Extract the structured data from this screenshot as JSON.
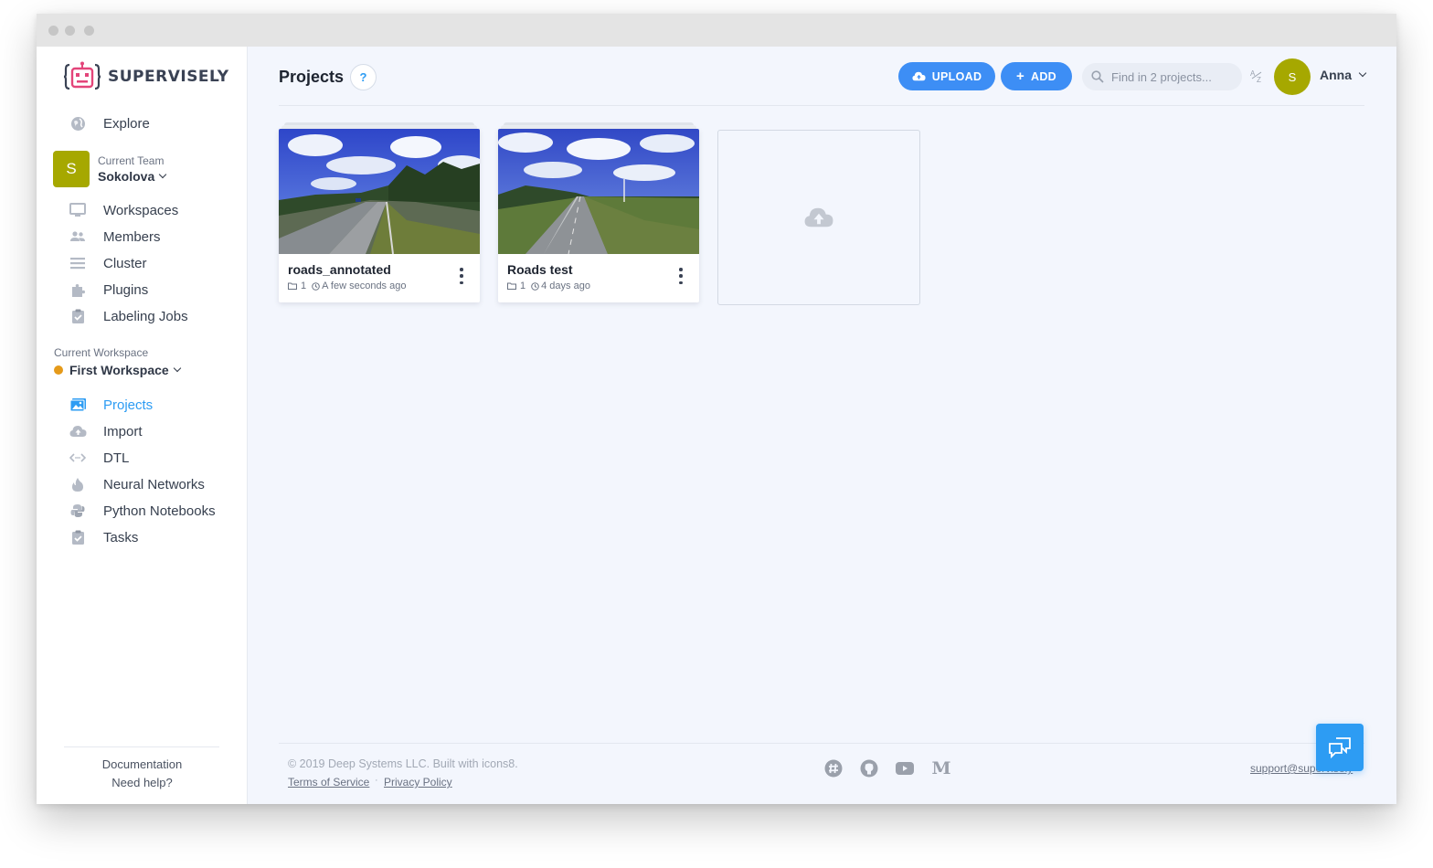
{
  "window": {
    "traffic_lights": [
      "close",
      "minimize",
      "maximize"
    ]
  },
  "brand": {
    "name": "SUPERVISELY",
    "logo_color": "#e3457a"
  },
  "sidebar": {
    "explore": {
      "label": "Explore",
      "icon": "globe-icon"
    },
    "team": {
      "caption": "Current Team",
      "name": "Sokolova",
      "initial": "S",
      "color": "#a6a800"
    },
    "team_items": [
      {
        "label": "Workspaces",
        "icon": "monitor-icon"
      },
      {
        "label": "Members",
        "icon": "people-icon"
      },
      {
        "label": "Cluster",
        "icon": "list-icon"
      },
      {
        "label": "Plugins",
        "icon": "puzzle-icon"
      },
      {
        "label": "Labeling Jobs",
        "icon": "clipboard-check-icon"
      }
    ],
    "workspace": {
      "caption": "Current Workspace",
      "name": "First Workspace",
      "status_color": "#e59a1a"
    },
    "workspace_items": [
      {
        "label": "Projects",
        "icon": "images-icon",
        "active": true
      },
      {
        "label": "Import",
        "icon": "cloud-upload-icon"
      },
      {
        "label": "DTL",
        "icon": "code-icon"
      },
      {
        "label": "Neural Networks",
        "icon": "flame-icon"
      },
      {
        "label": "Python Notebooks",
        "icon": "python-icon"
      },
      {
        "label": "Tasks",
        "icon": "clipboard-check-icon"
      }
    ],
    "footer": {
      "documentation": "Documentation",
      "help": "Need help?"
    }
  },
  "header": {
    "title": "Projects",
    "help": "?",
    "upload_label": "UPLOAD",
    "add_label": "ADD",
    "search_placeholder": "Find in 2 projects...",
    "user": {
      "initial": "S",
      "name": "Anna"
    },
    "accent": "#3d8ef5"
  },
  "projects": [
    {
      "name": "roads_annotated",
      "datasets": "1",
      "updated": "A few seconds ago"
    },
    {
      "name": "Roads test",
      "datasets": "1",
      "updated": "4 days ago"
    }
  ],
  "footer": {
    "copyright": "© 2019 Deep Systems LLC. Built with icons8.",
    "terms": "Terms of Service",
    "separator": "·",
    "privacy": "Privacy Policy",
    "social": [
      "slack-icon",
      "github-icon",
      "youtube-icon",
      "medium-icon"
    ],
    "medium_letter": "M",
    "support": "support@supervisely"
  }
}
